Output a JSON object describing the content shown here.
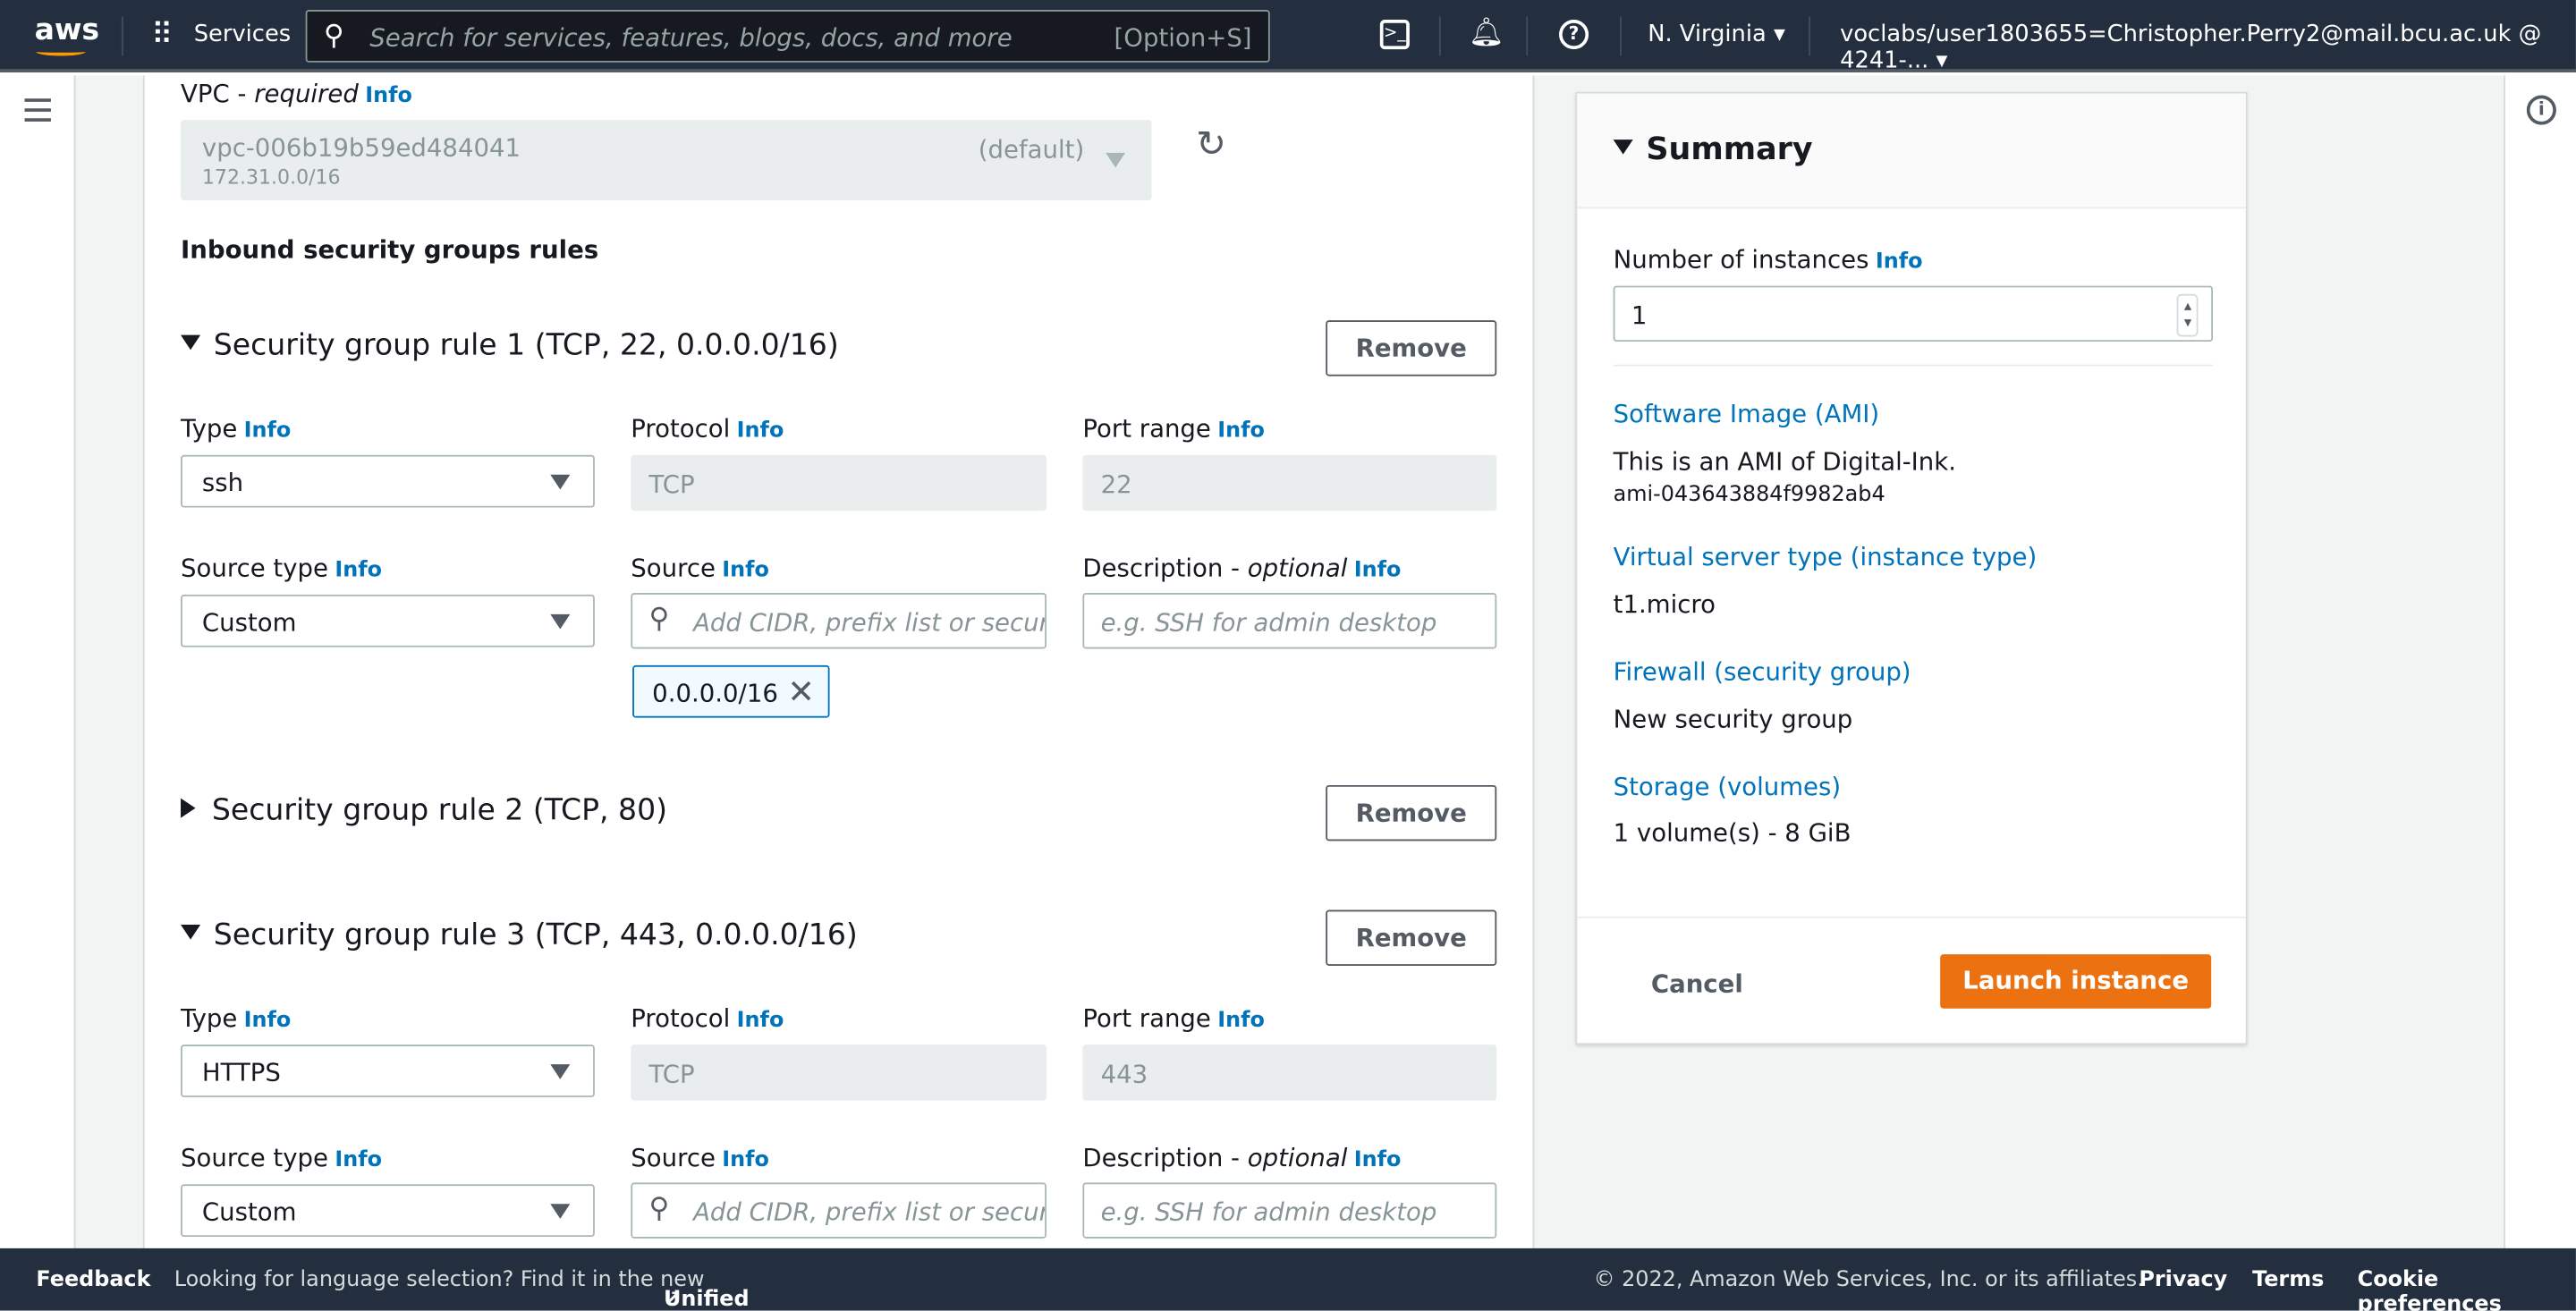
{
  "header": {
    "logo": "aws",
    "services": "Services",
    "search_placeholder": "Search for services, features, blogs, docs, and more",
    "search_shortcut": "[Option+S]",
    "region": "N. Virginia",
    "account": "voclabs/user1803655=Christopher.Perry2@mail.bcu.ac.uk @ 4241-..."
  },
  "vpc": {
    "label": "VPC - ",
    "required": "required",
    "info": "Info",
    "value": "vpc-006b19b59ed484041",
    "tag": "(default)",
    "cidr": "172.31.0.0/16"
  },
  "inbound_title": "Inbound security groups rules",
  "rules": [
    {
      "title": "Security group rule 1 (TCP, 22, 0.0.0.0/16)",
      "expanded": true,
      "type": "ssh",
      "protocol": "TCP",
      "port": "22",
      "source_type": "Custom",
      "source_chip": "0.0.0.0/16"
    },
    {
      "title": "Security group rule 2 (TCP, 80)",
      "expanded": false
    },
    {
      "title": "Security group rule 3 (TCP, 443, 0.0.0.0/16)",
      "expanded": true,
      "type": "HTTPS",
      "protocol": "TCP",
      "port": "443",
      "source_type": "Custom"
    }
  ],
  "labels": {
    "type": "Type",
    "protocol": "Protocol",
    "port_range": "Port range",
    "source_type": "Source type",
    "source": "Source",
    "description": "Description - ",
    "optional": "optional",
    "info": "Info",
    "remove": "Remove",
    "source_placeholder": "Add CIDR, prefix list or security group",
    "desc_placeholder": "e.g. SSH for admin desktop"
  },
  "summary": {
    "title": "Summary",
    "num_label": "Number of instances",
    "num_value": "1",
    "ami_link": "Software Image (AMI)",
    "ami_desc": "This is an AMI of Digital-Ink.",
    "ami_id": "ami-043643884f9982ab4",
    "type_link": "Virtual server type (instance type)",
    "type_value": "t1.micro",
    "fw_link": "Firewall (security group)",
    "fw_value": "New security group",
    "storage_link": "Storage (volumes)",
    "storage_value": "1 volume(s) - 8 GiB",
    "cancel": "Cancel",
    "launch": "Launch instance"
  },
  "footer": {
    "feedback": "Feedback",
    "lang_text": "Looking for language selection? Find it in the new",
    "unified": "Unified Settings",
    "copyright": "© 2022, Amazon Web Services, Inc. or its affiliates.",
    "privacy": "Privacy",
    "terms": "Terms",
    "cookies": "Cookie preferences"
  },
  "colors": {
    "accent": "#0073bb",
    "launch": "#ec7211",
    "nav": "#232f3e"
  }
}
